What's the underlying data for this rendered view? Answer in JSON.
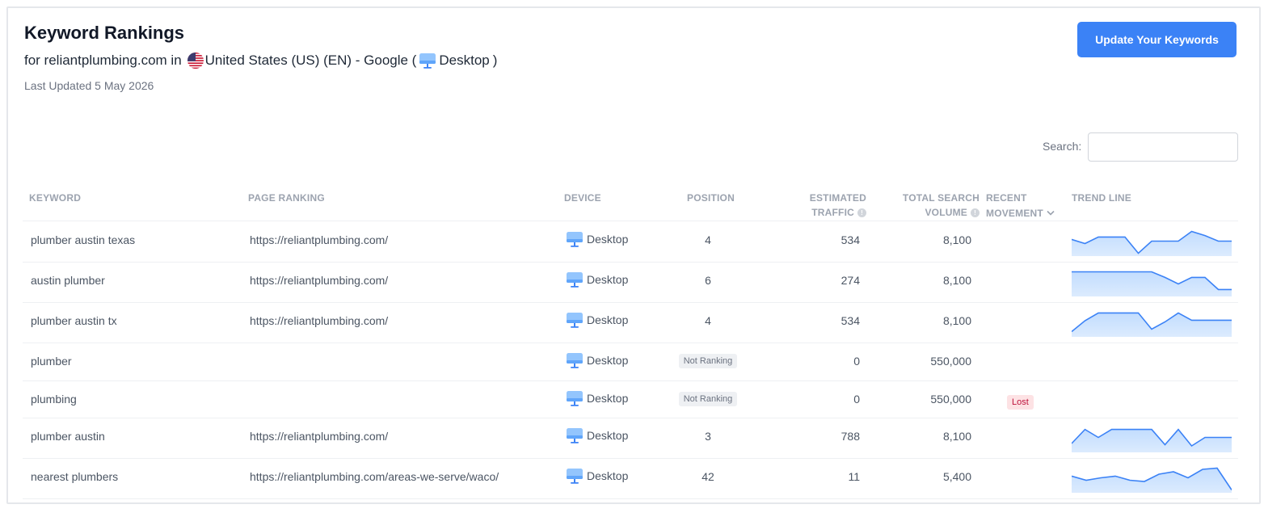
{
  "header": {
    "title": "Keyword Rankings",
    "sub_prefix": "for reliantplumbing.com in",
    "country": "United States (US) (EN) - Google (",
    "device": "Desktop",
    "close_paren": ")",
    "last_updated": "Last Updated 5 May 2026",
    "update_button": "Update Your Keywords"
  },
  "search": {
    "label": "Search:",
    "placeholder": "",
    "value": ""
  },
  "columns": {
    "keyword": "KEYWORD",
    "page": "PAGE RANKING",
    "device": "DEVICE",
    "position": "POSITION",
    "traffic_1": "ESTIMATED",
    "traffic_2": "TRAFFIC",
    "volume_1": "TOTAL SEARCH",
    "volume_2": "VOLUME",
    "movement_1": "RECENT",
    "movement_2": "MOVEMENT",
    "trend": "TREND LINE"
  },
  "rows": [
    {
      "keyword": "plumber austin texas",
      "page": "https://reliantplumbing.com/",
      "device": "Desktop",
      "position": "4",
      "traffic": "534",
      "volume": "8,100",
      "movement": "",
      "trend": [
        0.62,
        0.45,
        0.72,
        0.72,
        0.72,
        0.05,
        0.55,
        0.55,
        0.55,
        0.95,
        0.78,
        0.55,
        0.55
      ]
    },
    {
      "keyword": "austin plumber",
      "page": "https://reliantplumbing.com/",
      "device": "Desktop",
      "position": "6",
      "traffic": "274",
      "volume": "8,100",
      "movement": "",
      "trend": [
        0.95,
        0.95,
        0.95,
        0.95,
        0.95,
        0.95,
        0.95,
        0.72,
        0.45,
        0.72,
        0.72,
        0.22,
        0.22
      ]
    },
    {
      "keyword": "plumber austin tx",
      "page": "https://reliantplumbing.com/",
      "device": "Desktop",
      "position": "4",
      "traffic": "534",
      "volume": "8,100",
      "movement": "",
      "trend": [
        0.15,
        0.6,
        0.92,
        0.92,
        0.92,
        0.92,
        0.25,
        0.55,
        0.92,
        0.62,
        0.62,
        0.62,
        0.62
      ]
    },
    {
      "keyword": "plumber",
      "page": "",
      "device": "Desktop",
      "position": "Not Ranking",
      "traffic": "0",
      "volume": "550,000",
      "movement": "",
      "trend": []
    },
    {
      "keyword": "plumbing",
      "page": "",
      "device": "Desktop",
      "position": "Not Ranking",
      "traffic": "0",
      "volume": "550,000",
      "movement": "Lost",
      "trend": []
    },
    {
      "keyword": "plumber austin",
      "page": "https://reliantplumbing.com/",
      "device": "Desktop",
      "position": "3",
      "traffic": "788",
      "volume": "8,100",
      "movement": "",
      "trend": [
        0.3,
        0.88,
        0.55,
        0.88,
        0.88,
        0.88,
        0.88,
        0.25,
        0.88,
        0.2,
        0.55,
        0.55,
        0.55
      ]
    },
    {
      "keyword": "nearest plumbers",
      "page": "https://reliantplumbing.com/areas-we-serve/waco/",
      "device": "Desktop",
      "position": "42",
      "traffic": "11",
      "volume": "5,400",
      "movement": "",
      "trend": [
        0.62,
        0.45,
        0.55,
        0.62,
        0.45,
        0.4,
        0.7,
        0.8,
        0.55,
        0.9,
        0.95,
        0.05
      ]
    }
  ],
  "colors": {
    "accent": "#3b82f6",
    "trend_line": "#3b82f6",
    "trend_fill": "#bfdbfe",
    "lost_bg": "#fde2e4",
    "lost_text": "#be123c"
  }
}
